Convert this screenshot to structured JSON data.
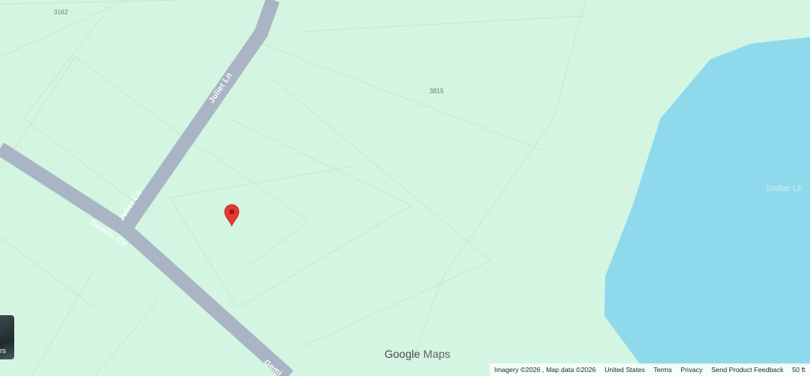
{
  "map": {
    "parcels": [
      "3162",
      "3815"
    ],
    "roads": [
      {
        "name": "Juliet Ln",
        "label": "Juliet Ln"
      },
      {
        "name": "Juliet Ln",
        "label": "Juliet Ln"
      },
      {
        "name": "Gemini Cir",
        "label": "Gemini Cir"
      },
      {
        "name": "Gemini Cir",
        "label": "Gemi"
      }
    ],
    "water_label": "Stellar Lk",
    "marker": "red-location-pin"
  },
  "colors": {
    "land": "#d4f5e2",
    "water": "#8fd9ec",
    "road": "#a9b5c4",
    "marker": "#e53935",
    "parcel_line": "#c4e8d2"
  },
  "thumbnail": {
    "caption": "rs"
  },
  "logo": {
    "google": "Google",
    "maps": "Maps"
  },
  "footer": {
    "imagery": "Imagery ©2026 , Map data ©2026",
    "country": "United States",
    "terms": "Terms",
    "privacy": "Privacy",
    "feedback": "Send Product Feedback",
    "scale": "50 ft"
  }
}
